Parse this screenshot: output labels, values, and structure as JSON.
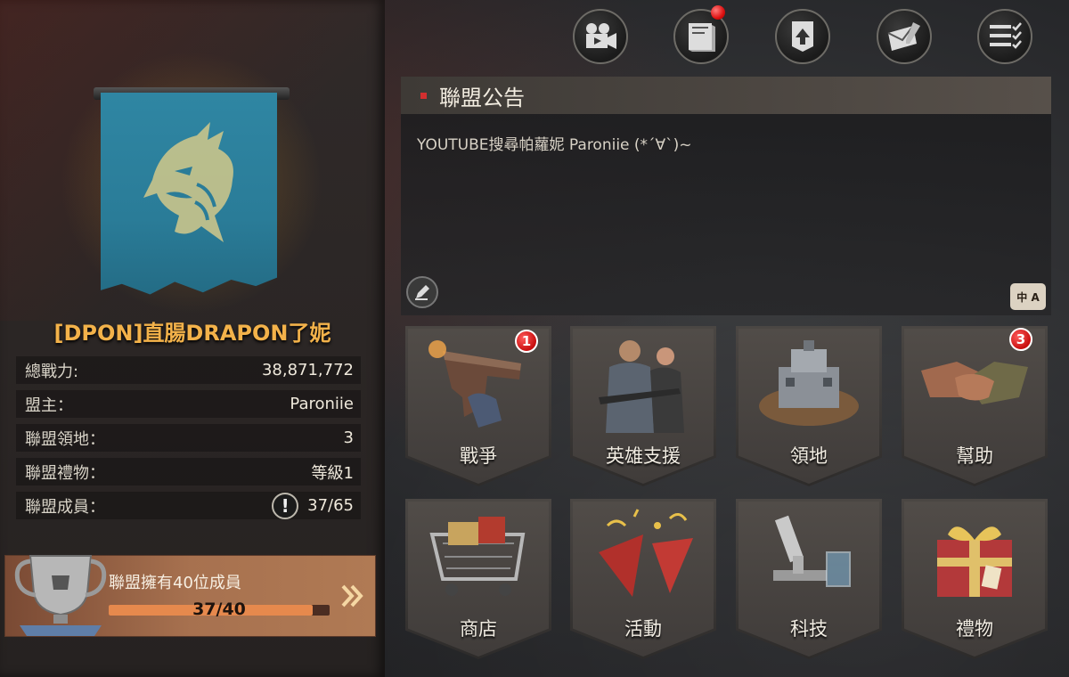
{
  "alliance": {
    "name": "[DPON]直腸DRAPON了妮",
    "stats": [
      {
        "label": "總戰力:",
        "value": "38,871,772"
      },
      {
        "label": "盟主：",
        "value": "Paroniie"
      },
      {
        "label": "聯盟領地：",
        "value": "3"
      },
      {
        "label": "聯盟禮物：",
        "value": "等級1"
      },
      {
        "label": "聯盟成員：",
        "value": "37/65"
      }
    ],
    "member_goal": {
      "label": "聯盟擁有40位成員",
      "progress_text": "37/40",
      "progress_fraction": 0.925
    }
  },
  "notice": {
    "title": "聯盟公告",
    "text": "YOUTUBE搜尋帕蘿妮 Paroniie (*´∀`)~",
    "translate_label": "中 A"
  },
  "top_icons": [
    "film-camera-icon",
    "book-icon",
    "upload-scroll-icon",
    "envelope-pen-icon",
    "checklist-icon"
  ],
  "tiles": [
    {
      "label": "戰爭",
      "badge": "1"
    },
    {
      "label": "英雄支援",
      "badge": ""
    },
    {
      "label": "領地",
      "badge": ""
    },
    {
      "label": "幫助",
      "badge": "3"
    },
    {
      "label": "商店",
      "badge": ""
    },
    {
      "label": "活動",
      "badge": ""
    },
    {
      "label": "科技",
      "badge": ""
    },
    {
      "label": "禮物",
      "badge": ""
    }
  ],
  "colors": {
    "alliance_name": "#f3b24a",
    "banner": "#2f86a3",
    "badge_red": "#c80f0f",
    "progress_fill": "#e6894d"
  }
}
